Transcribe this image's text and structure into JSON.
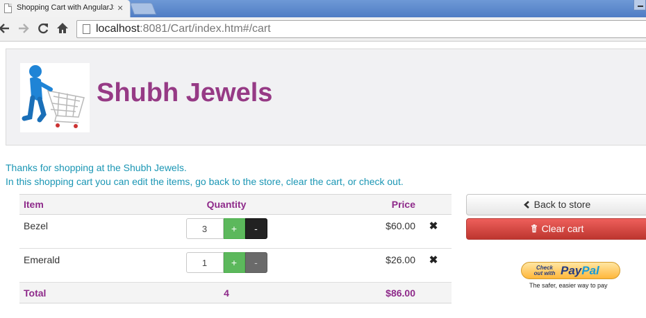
{
  "browser": {
    "tab_title": "Shopping Cart with AngularJS",
    "tab_close": "×",
    "url_host": "localhost",
    "url_rest": ":8081/Cart/index.htm#/cart"
  },
  "header": {
    "brand": "Shubh Jewels"
  },
  "intro": {
    "line1": "Thanks for shopping at the Shubh Jewels.",
    "line2": "In this shopping cart you can edit the items, go back to the store, clear the cart, or check out."
  },
  "cart": {
    "columns": {
      "item": "Item",
      "quantity": "Quantity",
      "price": "Price"
    },
    "rows": [
      {
        "name": "Bezel",
        "quantity": "3",
        "price": "$60.00"
      },
      {
        "name": "Emerald",
        "quantity": "1",
        "price": "$26.00"
      }
    ],
    "plus_label": "+",
    "minus_label": "-",
    "remove_glyph": "✖",
    "total": {
      "label": "Total",
      "quantity": "4",
      "price": "$86.00"
    }
  },
  "actions": {
    "back_icon": "chevron-left-icon",
    "back_label": "Back to store",
    "clear_icon": "trash-icon",
    "clear_label": "Clear cart"
  },
  "paypal": {
    "check_label": "Check out with",
    "brand_pay": "Pay",
    "brand_pal": "Pal",
    "tagline": "The safer, easier way to pay"
  },
  "colors": {
    "brand": "#963a85",
    "intro_text": "#1a96b4",
    "success": "#5cb85c",
    "danger": "#d9413d"
  }
}
